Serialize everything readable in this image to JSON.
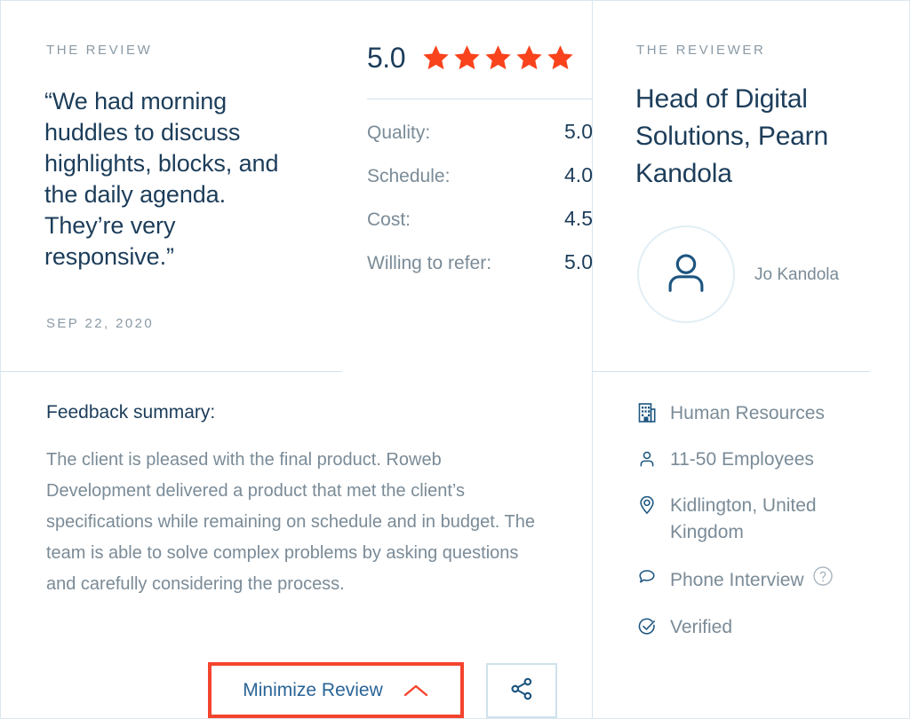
{
  "colors": {
    "star": "#f9431c",
    "heading": "#1c3d5a",
    "muted": "#7a8b97",
    "eyebrow": "#8a9aa6",
    "divider": "#cfe2ec",
    "highlight": "#f4442e",
    "link": "#2a6496",
    "icon": "#1c5580"
  },
  "review": {
    "eyebrow": "THE REVIEW",
    "quote": "“We had morning huddles to discuss highlights, blocks, and the daily agenda. They’re very responsive.”",
    "date": "SEP 22, 2020"
  },
  "ratings": {
    "overall_score": "5.0",
    "stars_filled": 5,
    "stars_total": 5,
    "rows": [
      {
        "label": "Quality:",
        "value": "5.0"
      },
      {
        "label": "Schedule:",
        "value": "4.0"
      },
      {
        "label": "Cost:",
        "value": "4.5"
      },
      {
        "label": "Willing to refer:",
        "value": "5.0"
      }
    ]
  },
  "feedback": {
    "title": "Feedback summary:",
    "body": "The client is pleased with the final product. Roweb Development delivered a product that met the client’s specifications while remaining on schedule and in budget. The team is able to solve complex problems by asking questions and carefully considering the process."
  },
  "actions": {
    "minimize_label": "Minimize Review",
    "minimize_icon": "chevron-up-icon",
    "share_icon": "share-icon"
  },
  "reviewer": {
    "eyebrow": "THE REVIEWER",
    "title": "Head of Digital Solutions, Pearn Kandola",
    "avatar_icon": "person-icon",
    "name": "Jo Kandola",
    "meta": [
      {
        "icon": "building-icon",
        "text": "Human Resources"
      },
      {
        "icon": "person-icon",
        "text": "11-50 Employees"
      },
      {
        "icon": "location-pin-icon",
        "text": "Kidlington, United Kingdom"
      },
      {
        "icon": "speech-bubble-icon",
        "text": "Phone Interview",
        "help": "?"
      },
      {
        "icon": "check-circle-icon",
        "text": "Verified"
      }
    ]
  }
}
